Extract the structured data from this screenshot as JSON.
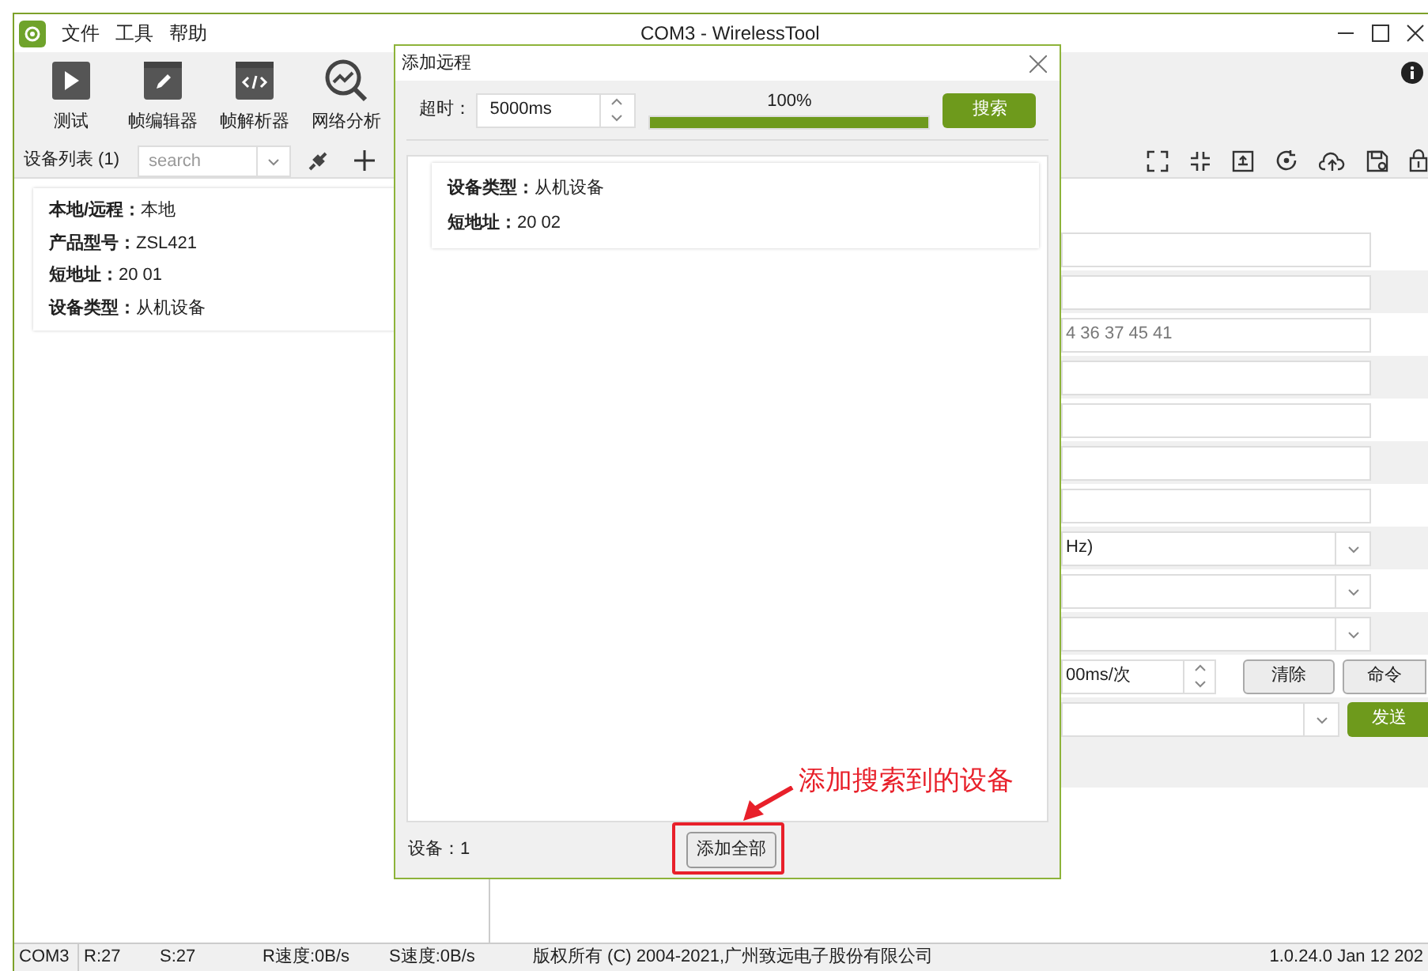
{
  "window": {
    "title": "COM3 - WirelessTool"
  },
  "menu": [
    "文件",
    "工具",
    "帮助"
  ],
  "toolbar": [
    {
      "label": "测试",
      "kind": "play"
    },
    {
      "label": "帧编辑器",
      "kind": "edit"
    },
    {
      "label": "帧解析器",
      "kind": "code"
    },
    {
      "label": "网络分析",
      "kind": "analyze"
    }
  ],
  "device_list": {
    "title": "设备列表 (1)",
    "search_placeholder": "search",
    "devices": [
      {
        "lines": [
          "**本地/远程：**本地",
          "**产品型号：**ZSL421",
          "**短地址：**20 01",
          "**设备类型：**从机设备"
        ]
      }
    ]
  },
  "form": {
    "fields": [
      {
        "kind": "text"
      },
      {
        "kind": "text"
      },
      {
        "kind": "text",
        "value": "4 36 37 45 41"
      },
      {
        "kind": "text"
      },
      {
        "kind": "text"
      },
      {
        "kind": "text"
      },
      {
        "kind": "text"
      },
      {
        "kind": "combo",
        "value": "Hz)"
      },
      {
        "kind": "combo"
      },
      {
        "kind": "combo"
      }
    ],
    "interval": "00ms/次",
    "clear_button": "清除",
    "command_button": "命令",
    "send_button": "发送"
  },
  "dialog": {
    "title": "添加远程",
    "timeout_label": "超时：",
    "timeout": "5000ms",
    "progress": {
      "level": 1,
      "text": "100%"
    },
    "search_button": "搜索",
    "results": [
      {
        "lines": [
          "**设备类型：**从机设备",
          "**短地址：**20 02"
        ]
      }
    ],
    "count": "设备：1",
    "add_all_button": "添加全部"
  },
  "annotation": {
    "text": "添加搜索到的设备"
  },
  "status_bar": [
    "COM3",
    "R:27",
    "S:27",
    "R速度:0B/s",
    "S速度:0B/s",
    "版权所有 (C) 2004-2021,广州致远电子股份有限公司",
    "1.0.24.0 Jan 12 202"
  ]
}
